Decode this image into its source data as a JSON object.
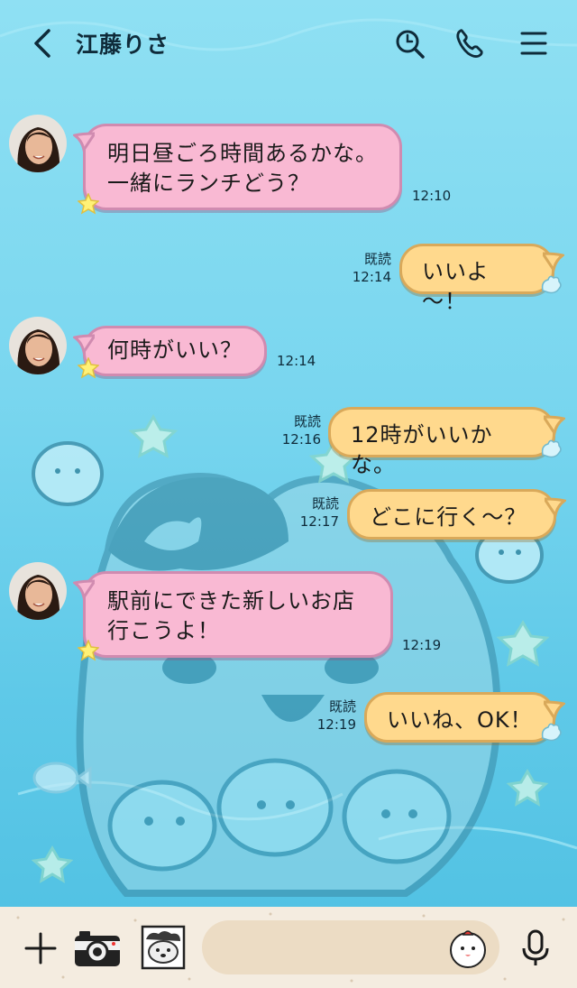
{
  "header": {
    "contact_name": "江藤りさ",
    "icons": [
      "back-arrow-icon",
      "search-icon",
      "phone-icon",
      "menu-icon"
    ]
  },
  "messages": [
    {
      "side": "left",
      "lines": [
        "明日昼ごろ時間あるかな。",
        "一緒にランチどう？"
      ],
      "time": "12:10"
    },
    {
      "side": "right",
      "lines": [
        "いいよ～！"
      ],
      "read": "既読",
      "time": "12:14"
    },
    {
      "side": "left",
      "lines": [
        "何時がいい？"
      ],
      "time": "12:14"
    },
    {
      "side": "right",
      "lines": [
        "12時がいいかな。"
      ],
      "read": "既読",
      "time": "12:16"
    },
    {
      "side": "right",
      "lines": [
        "どこに行く～？"
      ],
      "read": "既読",
      "time": "12:17"
    },
    {
      "side": "left",
      "lines": [
        "駅前にできた新しいお店",
        "行こうよ！"
      ],
      "time": "12:19"
    },
    {
      "side": "right",
      "lines": [
        "いいね、OK！"
      ],
      "read": "既読",
      "time": "12:19"
    }
  ],
  "bottom": {
    "input_value": "",
    "icons": [
      "plus-icon",
      "camera-icon",
      "photo-sticker-icon",
      "emoji-icon",
      "microphone-icon"
    ]
  },
  "colors": {
    "background_top": "#8fe0f3",
    "background_bottom": "#4ec0e2",
    "left_bubble": "#f9b9d3",
    "right_bubble": "#ffd98d",
    "bottom_bar": "#f4ece0"
  }
}
